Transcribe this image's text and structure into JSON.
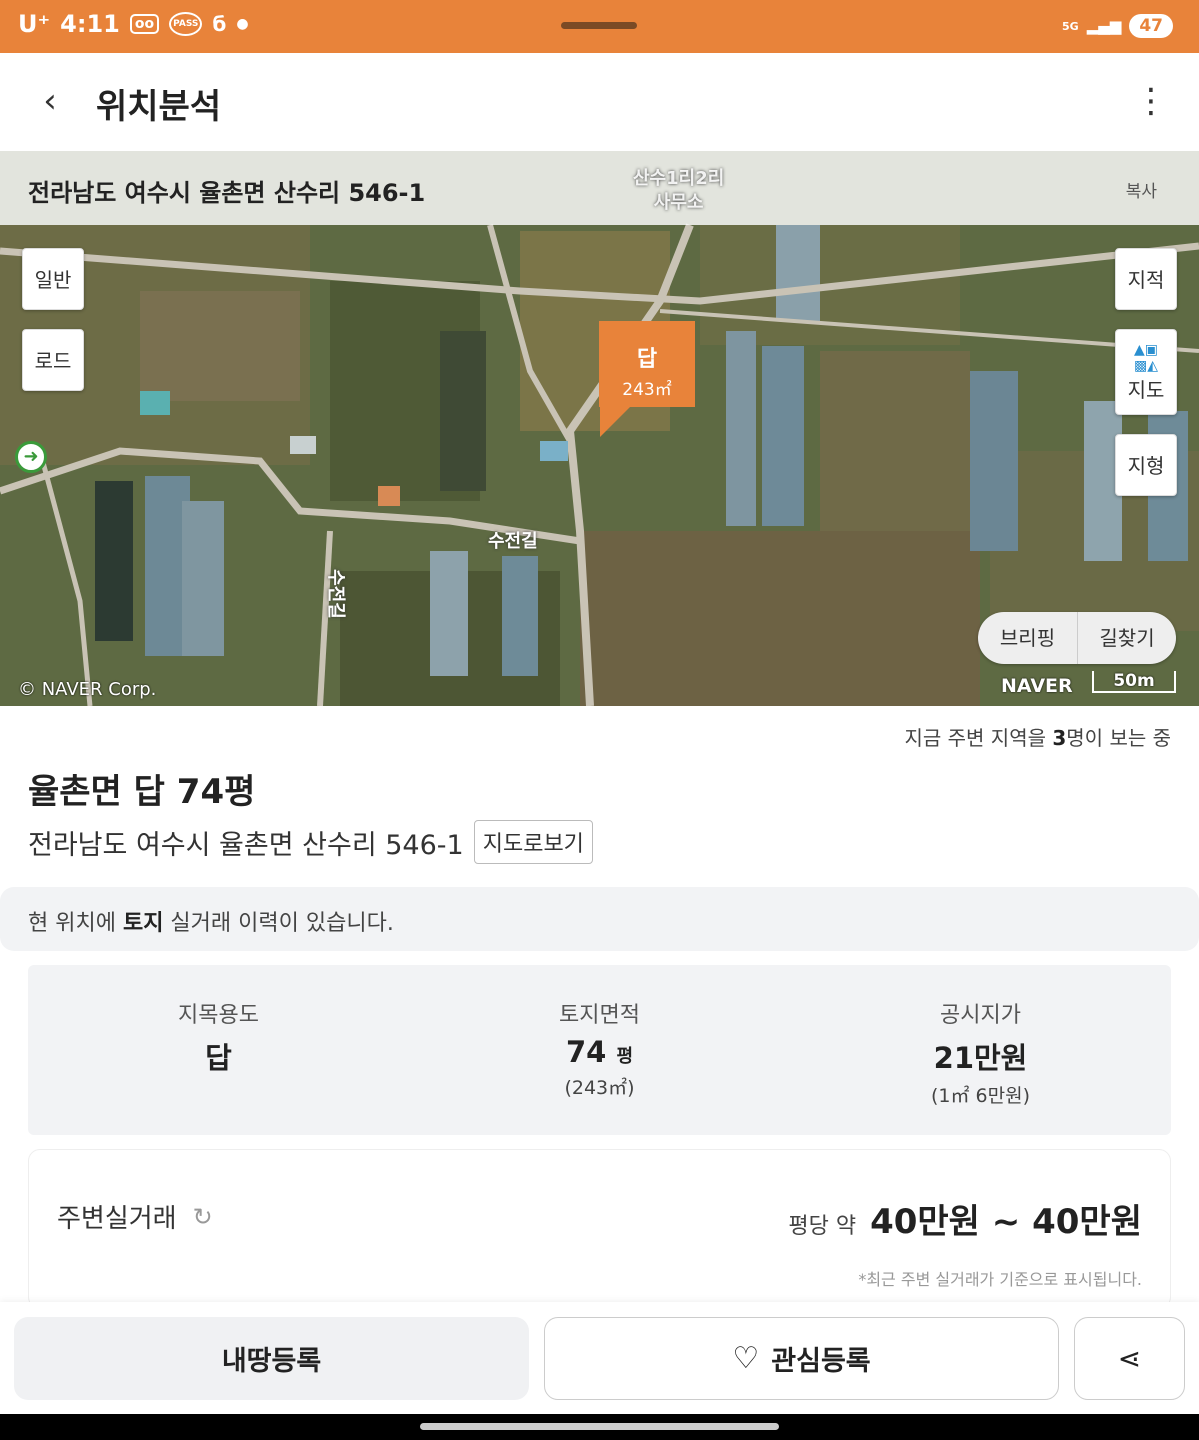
{
  "status": {
    "carrier": "U⁺",
    "time": "4:11",
    "pass": "PASS",
    "battery": "47",
    "network": "5G"
  },
  "appbar": {
    "title": "위치분석"
  },
  "map": {
    "address": "전라남도 여수시 율촌면 산수리 546-1",
    "copy_label": "복사",
    "btn_general": "일반",
    "btn_road": "로드",
    "btn_cadastral": "지적",
    "btn_map": "지도",
    "btn_terrain": "지형",
    "marker_type": "답",
    "marker_area": "243㎡",
    "place_office": "산수1리2리\n사무소",
    "road1": "수전길",
    "road2": "수전길",
    "btn_briefing": "브리핑",
    "btn_directions": "길찾기",
    "copyright": "© NAVER Corp.",
    "naver": "NAVER",
    "scale": "50m"
  },
  "viewers": {
    "pre": "지금 주변 지역을 ",
    "count": "3",
    "post": "명이 보는 중"
  },
  "property": {
    "title": "율촌면 답 74평",
    "address": "전라남도 여수시 율촌면 산수리 546-1",
    "map_view": "지도로보기"
  },
  "notice": {
    "pre": "현 위치에 ",
    "bold": "토지",
    "post": " 실거래 이력이 있습니다."
  },
  "info": {
    "use_label": "지목용도",
    "use_value": "답",
    "area_label": "토지면적",
    "area_value": "74",
    "area_unit": "평",
    "area_sub": "(243㎡)",
    "price_label": "공시지가",
    "price_value": "21만원",
    "price_sub": "(1㎡ 6만원)"
  },
  "trade": {
    "title": "주변실거래",
    "pre": "평당 약",
    "range": "40만원 ~ 40만원",
    "note": "*최근 주변 실거래가 기준으로 표시됩니다."
  },
  "bottom": {
    "register": "내땅등록",
    "favorite": "관심등록"
  },
  "colors": {
    "accent": "#E8833A"
  }
}
